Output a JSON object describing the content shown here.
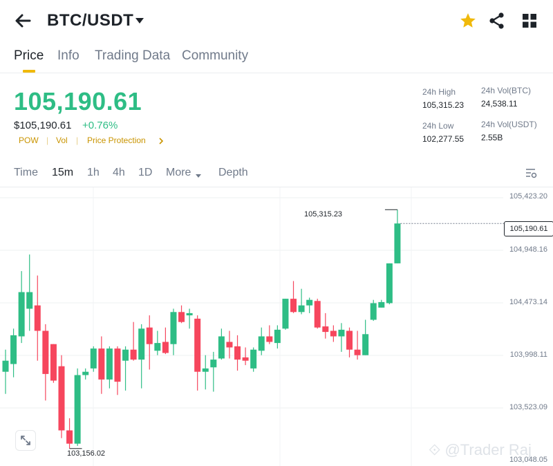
{
  "header": {
    "back_icon": "arrow-left-icon",
    "title": "BTC/USDT",
    "title_dropdown_icon": "caret-down-icon",
    "favorite_icon": "star-icon",
    "share_icon": "share-icon",
    "grid_icon": "grid-icon",
    "accent_color": "#f0b90b"
  },
  "tabs": [
    {
      "label": "Price",
      "active": true
    },
    {
      "label": "Info"
    },
    {
      "label": "Trading Data"
    },
    {
      "label": "Community"
    }
  ],
  "price": {
    "last": "105,190.61",
    "usd": "$105,190.61",
    "change": "+0.76%",
    "up_color": "#2ebd85",
    "down_color": "#f6465d",
    "tags": [
      "POW",
      "Vol",
      "Price Protection"
    ]
  },
  "stats": {
    "high_label": "24h High",
    "high_value": "105,315.23",
    "low_label": "24h Low",
    "low_value": "102,277.55",
    "vol_btc_label": "24h Vol(BTC)",
    "vol_btc_value": "24,538.11",
    "vol_usdt_label": "24h Vol(USDT)",
    "vol_usdt_value": "2.55B"
  },
  "timeframes": [
    "Time",
    "15m",
    "1h",
    "4h",
    "1D",
    "More",
    "Depth"
  ],
  "active_timeframe": "15m",
  "settings_icon": "chart-settings-icon",
  "expand_icon": "expand-icon",
  "chart": {
    "y_labels": [
      "105,423.20",
      "104,948.16",
      "104,473.14",
      "103,998.11",
      "103,523.09",
      "103,048.05"
    ],
    "current_price_label": "105,190.61",
    "high_marker": "105,315.23",
    "low_marker": "103,156.02"
  },
  "chart_data": {
    "type": "candlestick",
    "interval": "15m",
    "ylim": [
      103048.05,
      105423.2
    ],
    "current_price": 105190.61,
    "candles": [
      {
        "o": 103850,
        "h": 104050,
        "l": 103650,
        "c": 103950
      },
      {
        "o": 103920,
        "h": 104240,
        "l": 103800,
        "c": 104180
      },
      {
        "o": 104170,
        "h": 104760,
        "l": 104110,
        "c": 104570
      },
      {
        "o": 104420,
        "h": 104910,
        "l": 104220,
        "c": 104570
      },
      {
        "o": 104450,
        "h": 104720,
        "l": 103950,
        "c": 104220
      },
      {
        "o": 104220,
        "h": 104280,
        "l": 103590,
        "c": 103830
      },
      {
        "o": 104100,
        "h": 104100,
        "l": 103750,
        "c": 103770
      },
      {
        "o": 103900,
        "h": 104000,
        "l": 103250,
        "c": 103320
      },
      {
        "o": 103320,
        "h": 103430,
        "l": 103156,
        "c": 103200
      },
      {
        "o": 103200,
        "h": 103880,
        "l": 103180,
        "c": 103820
      },
      {
        "o": 103820,
        "h": 103880,
        "l": 103780,
        "c": 103850
      },
      {
        "o": 103880,
        "h": 104080,
        "l": 103850,
        "c": 104060
      },
      {
        "o": 104060,
        "h": 104170,
        "l": 103650,
        "c": 103780
      },
      {
        "o": 103780,
        "h": 104080,
        "l": 103700,
        "c": 104060
      },
      {
        "o": 104060,
        "h": 104080,
        "l": 103640,
        "c": 103760
      },
      {
        "o": 103950,
        "h": 104080,
        "l": 103680,
        "c": 104050
      },
      {
        "o": 104050,
        "h": 104300,
        "l": 103950,
        "c": 103960
      },
      {
        "o": 103960,
        "h": 104280,
        "l": 103700,
        "c": 104240
      },
      {
        "o": 104250,
        "h": 104360,
        "l": 103870,
        "c": 104100
      },
      {
        "o": 104040,
        "h": 104220,
        "l": 104000,
        "c": 104110
      },
      {
        "o": 104120,
        "h": 104250,
        "l": 104010,
        "c": 104020
      },
      {
        "o": 104100,
        "h": 104420,
        "l": 104000,
        "c": 104390
      },
      {
        "o": 104390,
        "h": 104450,
        "l": 104290,
        "c": 104300
      },
      {
        "o": 104360,
        "h": 104420,
        "l": 104240,
        "c": 104380
      },
      {
        "o": 104330,
        "h": 104360,
        "l": 103680,
        "c": 103850
      },
      {
        "o": 103850,
        "h": 104000,
        "l": 103690,
        "c": 103880
      },
      {
        "o": 103890,
        "h": 104030,
        "l": 103670,
        "c": 103960
      },
      {
        "o": 103970,
        "h": 104240,
        "l": 103960,
        "c": 104170
      },
      {
        "o": 104120,
        "h": 104220,
        "l": 103970,
        "c": 104070
      },
      {
        "o": 104080,
        "h": 104180,
        "l": 103860,
        "c": 103960
      },
      {
        "o": 103980,
        "h": 104070,
        "l": 103910,
        "c": 103950
      },
      {
        "o": 103880,
        "h": 104070,
        "l": 103850,
        "c": 104050
      },
      {
        "o": 104040,
        "h": 104250,
        "l": 104000,
        "c": 104170
      },
      {
        "o": 104170,
        "h": 104270,
        "l": 104100,
        "c": 104120
      },
      {
        "o": 104110,
        "h": 104270,
        "l": 104060,
        "c": 104230
      },
      {
        "o": 104240,
        "h": 104510,
        "l": 104230,
        "c": 104510
      },
      {
        "o": 104510,
        "h": 104670,
        "l": 104380,
        "c": 104390
      },
      {
        "o": 104390,
        "h": 104600,
        "l": 104370,
        "c": 104450
      },
      {
        "o": 104450,
        "h": 104520,
        "l": 104380,
        "c": 104500
      },
      {
        "o": 104490,
        "h": 104510,
        "l": 104240,
        "c": 104250
      },
      {
        "o": 104260,
        "h": 104380,
        "l": 104150,
        "c": 104210
      },
      {
        "o": 104220,
        "h": 104270,
        "l": 104120,
        "c": 104170
      },
      {
        "o": 104170,
        "h": 104290,
        "l": 104030,
        "c": 104230
      },
      {
        "o": 104220,
        "h": 104250,
        "l": 103980,
        "c": 104050
      },
      {
        "o": 104050,
        "h": 104220,
        "l": 103960,
        "c": 104000
      },
      {
        "o": 104000,
        "h": 104320,
        "l": 104000,
        "c": 104190
      },
      {
        "o": 104320,
        "h": 104500,
        "l": 104310,
        "c": 104470
      },
      {
        "o": 104430,
        "h": 104500,
        "l": 104430,
        "c": 104480
      },
      {
        "o": 104470,
        "h": 104830,
        "l": 104460,
        "c": 104830
      },
      {
        "o": 104830,
        "h": 105315.23,
        "l": 104830,
        "c": 105190.61
      }
    ]
  }
}
